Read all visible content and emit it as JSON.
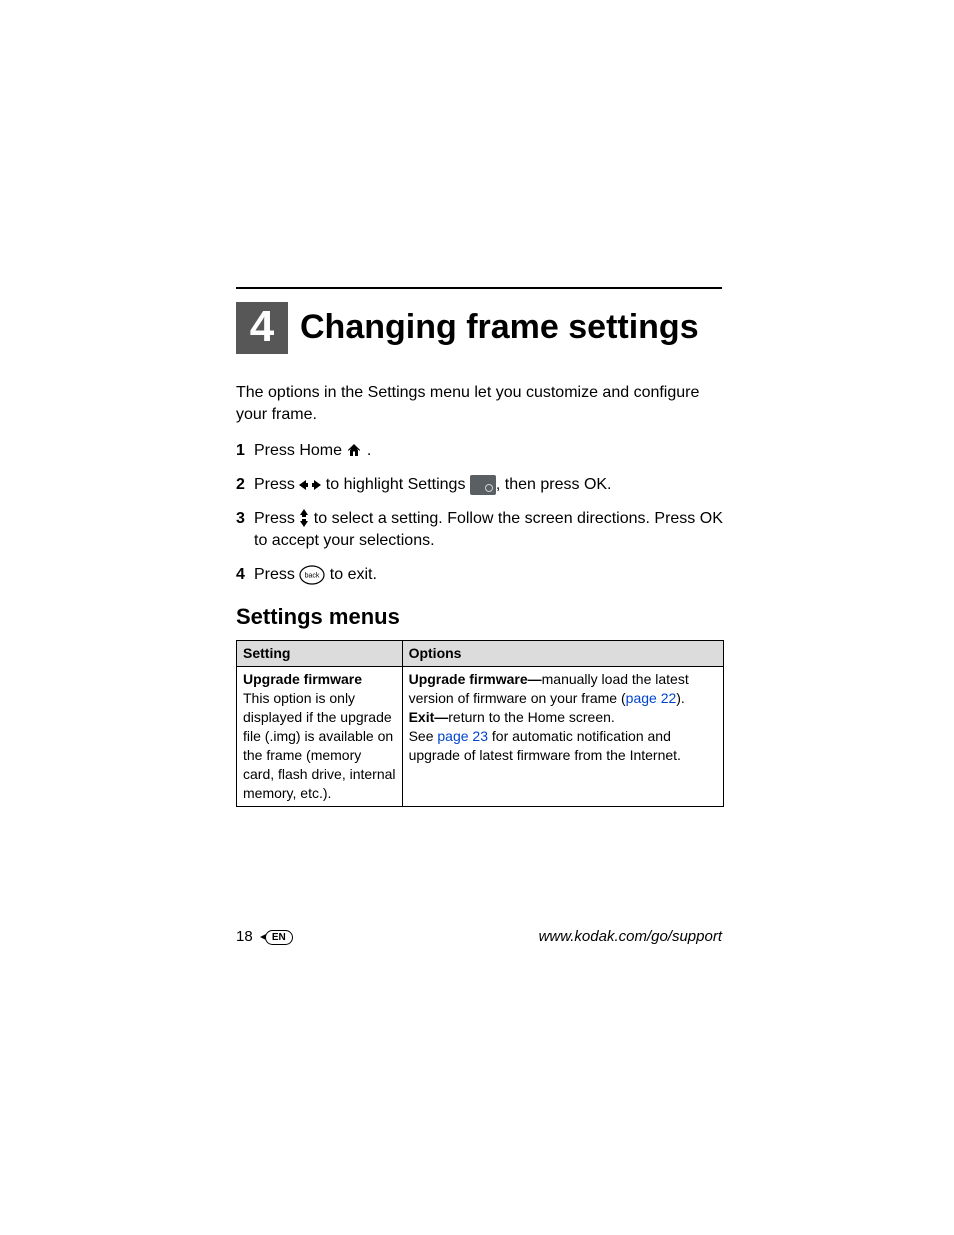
{
  "chapter": {
    "number": "4",
    "title": "Changing frame settings"
  },
  "intro": "The options in the Settings menu let you customize and configure your frame.",
  "steps": {
    "s1": {
      "a": "Press Home ",
      "b": " ."
    },
    "s2": {
      "a": "Press ",
      "b": " to highlight Settings ",
      "c": ", then press OK."
    },
    "s3": {
      "a": "Press ",
      "b": " to select a setting. Follow the screen directions. Press OK to accept your selections."
    },
    "s4": {
      "a": "Press ",
      "b": " to exit."
    }
  },
  "back_label": "back",
  "section_heading": "Settings menus",
  "table": {
    "headers": {
      "c1": "Setting",
      "c2": "Options"
    },
    "row1": {
      "setting_name": "Upgrade firmware",
      "setting_note": "This option is only displayed if the upgrade file (.img) is available on the frame (memory card, flash drive, internal memory, etc.).",
      "opt1_bold": "Upgrade firmware—",
      "opt1_rest_a": "manually load the latest version of firmware on your frame (",
      "opt1_link": "page 22",
      "opt1_rest_b": ").",
      "opt2_bold": "Exit—",
      "opt2_rest": "return to the Home screen.",
      "opt3_a": "See ",
      "opt3_link": "page 23",
      "opt3_b": " for automatic notification and upgrade of latest firmware from the Internet."
    }
  },
  "footer": {
    "page_number": "18",
    "lang": "EN",
    "url": "www.kodak.com/go/support"
  }
}
